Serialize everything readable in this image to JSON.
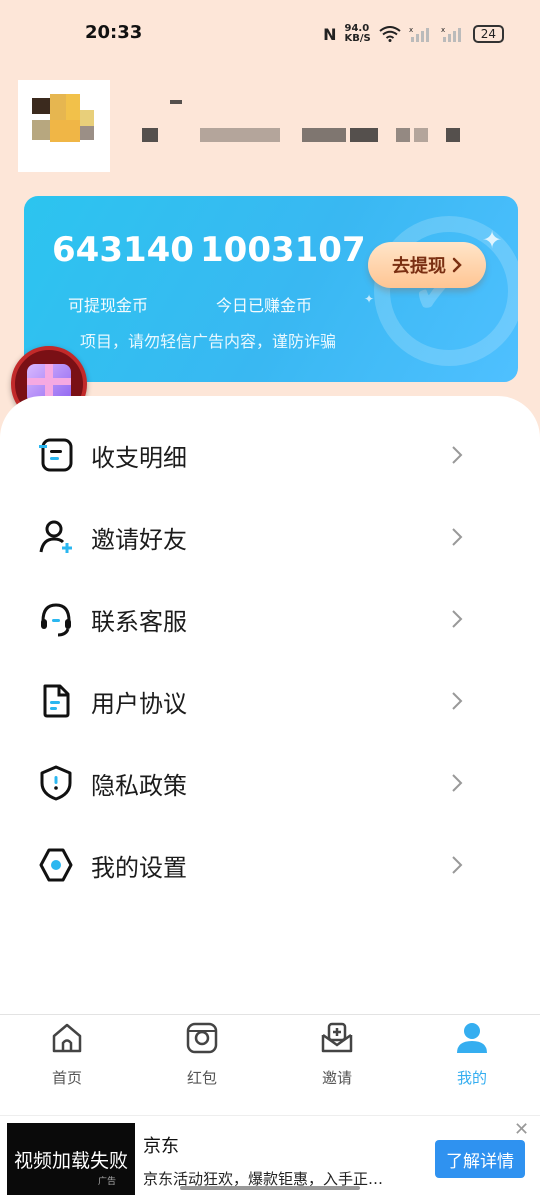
{
  "status_bar": {
    "time": "20:33",
    "nfc": "N",
    "speed_value": "94.0",
    "speed_unit": "KB/S",
    "battery": "24"
  },
  "coin_card": {
    "withdrawable_coins": "643140",
    "withdrawable_label": "可提现金币",
    "today_coins": "1003107",
    "today_label": "今日已赚金币",
    "withdraw_button": "去提现",
    "notice": "项目，请勿轻信广告内容，谨防诈骗"
  },
  "menu": {
    "items": [
      {
        "label": "收支明细",
        "icon": "ledger-icon"
      },
      {
        "label": "邀请好友",
        "icon": "add-user-icon"
      },
      {
        "label": "联系客服",
        "icon": "headset-icon"
      },
      {
        "label": "用户协议",
        "icon": "document-icon"
      },
      {
        "label": "隐私政策",
        "icon": "shield-icon"
      },
      {
        "label": "我的设置",
        "icon": "settings-icon"
      }
    ]
  },
  "bottom_nav": {
    "items": [
      {
        "label": "首页",
        "icon": "home-icon"
      },
      {
        "label": "红包",
        "icon": "red-packet-icon"
      },
      {
        "label": "邀请",
        "icon": "invite-icon"
      },
      {
        "label": "我的",
        "icon": "profile-icon"
      }
    ],
    "active": "我的"
  },
  "ad": {
    "video_text": "视频加载失败",
    "tag": "广告",
    "title": "京东",
    "description": "京东活动狂欢，爆款钜惠，入手正…",
    "button": "了解详情",
    "close": "✕"
  },
  "colors": {
    "accent": "#35aef0",
    "card_gradient_start": "#2cc4ef",
    "header_bg": "#fde6d8"
  }
}
